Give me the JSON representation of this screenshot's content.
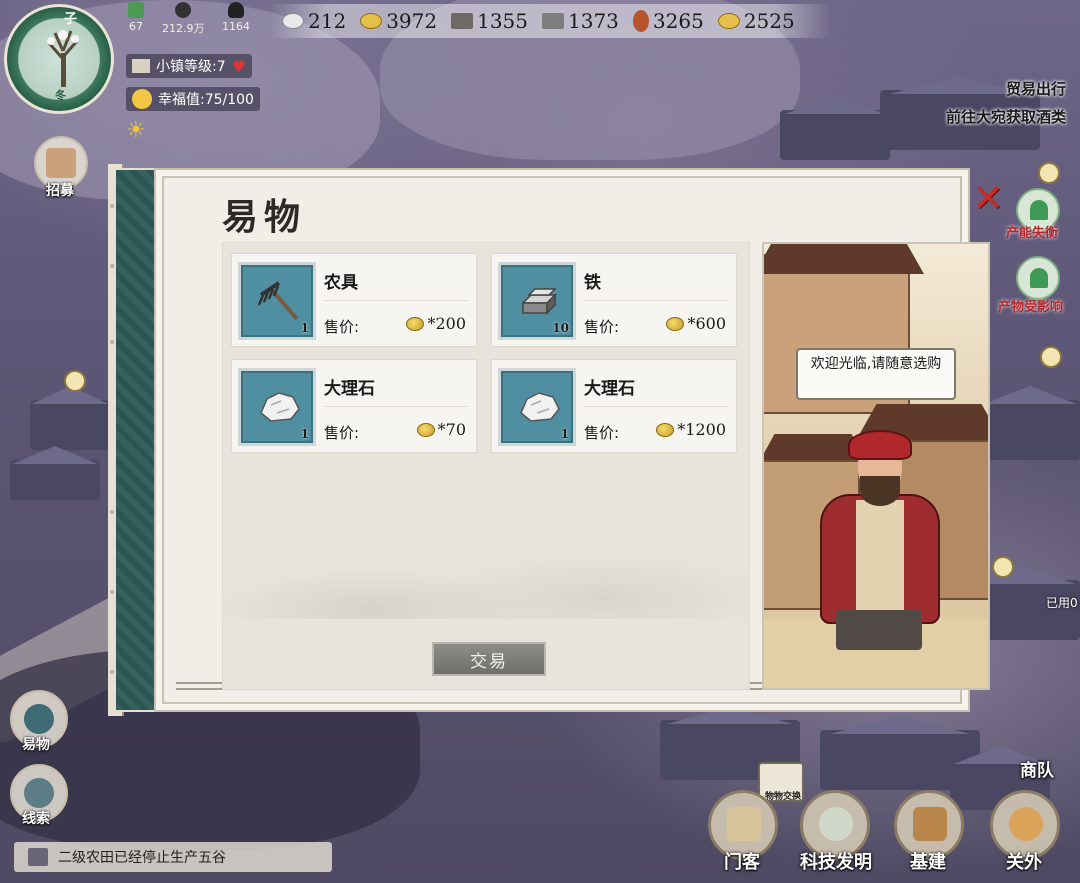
{
  "hud": {
    "season_char": "冬",
    "corner_char": "子",
    "small_stats": [
      {
        "icon": "idle-leaf-icon",
        "value": "67"
      },
      {
        "icon": "population-icon",
        "value": "212.9万"
      },
      {
        "icon": "storage-icon",
        "value": "1164"
      }
    ],
    "town_level": "小镇等级:7",
    "happiness": "幸福值:75/100",
    "resources": [
      {
        "icon": "silver-ingot-icon",
        "value": "212"
      },
      {
        "icon": "copper-coins-icon",
        "value": "3972"
      },
      {
        "icon": "rake-icon",
        "value": "1355"
      },
      {
        "icon": "iron-bar-icon",
        "value": "1373"
      },
      {
        "icon": "meat-icon",
        "value": "3265"
      },
      {
        "icon": "coins-icon",
        "value": "2525"
      }
    ]
  },
  "left_menu": {
    "recruit": "招募",
    "barter": "易物",
    "clues": "线索"
  },
  "right_panel": {
    "trade_title": "贸易出行",
    "trade_task": "前往大宛获取酒类",
    "capacity_label": "产能失衡",
    "impact_label": "产物受影响",
    "used_label": "已用0"
  },
  "dialog": {
    "title": "易物",
    "close_glyph": "✕",
    "price_label": "售价:",
    "trade_button": "交易",
    "merchant_speech": "欢迎光临,请随意选购",
    "items": [
      {
        "name": "农具",
        "qty": "1",
        "price": "*200",
        "icon": "rake-icon"
      },
      {
        "name": "铁",
        "qty": "10",
        "price": "*600",
        "icon": "iron-ingot-icon"
      },
      {
        "name": "大理石",
        "qty": "1",
        "price": "*70",
        "icon": "marble-icon"
      },
      {
        "name": "大理石",
        "qty": "1",
        "price": "*1200",
        "icon": "marble-icon"
      }
    ]
  },
  "bottom": {
    "notice": "二级农田已经停止生产五谷",
    "exchange_tag": "物物交换",
    "team": "商队",
    "buttons": [
      "门客",
      "科技发明",
      "基建",
      "关外"
    ]
  },
  "colors": {
    "close_red": "#c62d28",
    "spine_teal": "#35615f",
    "thumb_blue": "#4f8fa1",
    "coin_gold": "#e0b640"
  }
}
